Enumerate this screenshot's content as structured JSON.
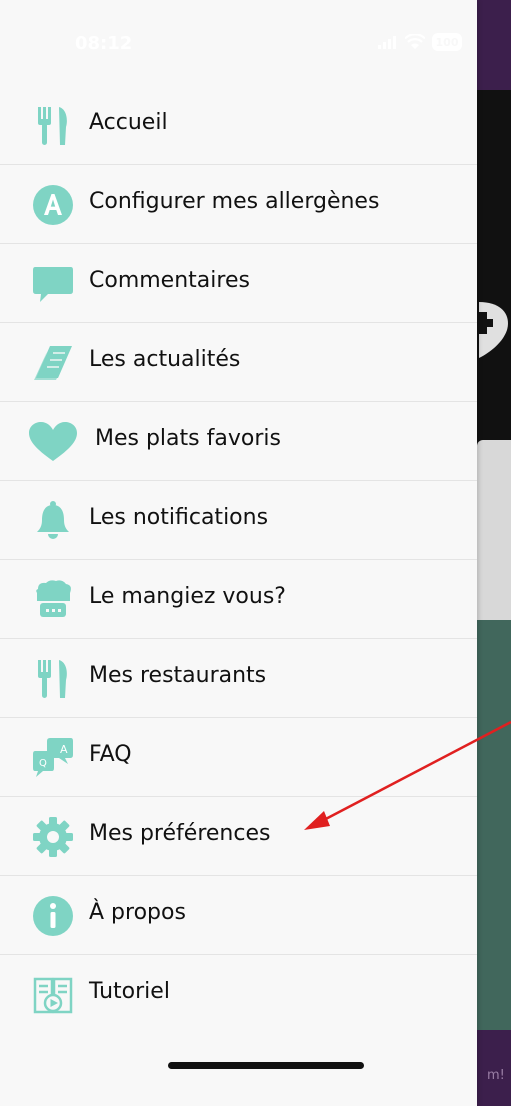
{
  "status_bar": {
    "time": "08:12",
    "battery": "100"
  },
  "colors": {
    "icon": "#7fd4c4",
    "arrow": "#e02020",
    "bg_purple": "#3c1f4c",
    "bg_green": "#41675c"
  },
  "menu": {
    "items": [
      {
        "label": "Accueil",
        "icon": "fork-knife-icon"
      },
      {
        "label": "Configurer mes allergènes",
        "icon": "allergen-a-icon"
      },
      {
        "label": "Commentaires",
        "icon": "comment-bubble-icon"
      },
      {
        "label": "Les actualités",
        "icon": "newspaper-icon"
      },
      {
        "label": "Mes plats favoris",
        "icon": "heart-icon"
      },
      {
        "label": "Les notifications",
        "icon": "bell-icon"
      },
      {
        "label": "Le mangiez vous?",
        "icon": "chef-hat-icon"
      },
      {
        "label": "Mes restaurants",
        "icon": "fork-knife-icon"
      },
      {
        "label": "FAQ",
        "icon": "faq-bubbles-icon"
      },
      {
        "label": "Mes préférences",
        "icon": "gear-icon"
      },
      {
        "label": "À propos",
        "icon": "info-icon"
      },
      {
        "label": "Tutoriel",
        "icon": "tutorial-video-icon"
      }
    ]
  },
  "background_text": {
    "edge_text": "m!"
  }
}
